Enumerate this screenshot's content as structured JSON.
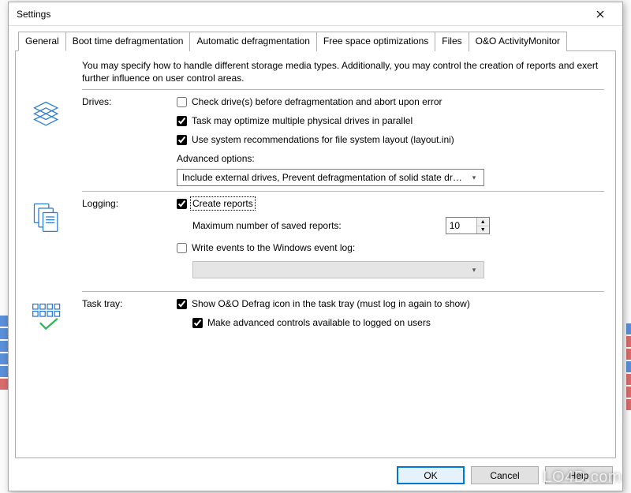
{
  "window": {
    "title": "Settings"
  },
  "tabs": {
    "general": "General",
    "boot": "Boot time defragmentation",
    "auto": "Automatic defragmentation",
    "free": "Free space optimizations",
    "files": "Files",
    "monitor": "O&O ActivityMonitor"
  },
  "intro": "You may specify how to handle different storage media types. Additionally, you may control the creation of reports and exert further influence on user control areas.",
  "drives": {
    "label": "Drives:",
    "check_before": {
      "label": "Check drive(s) before defragmentation and abort upon error",
      "checked": false
    },
    "parallel": {
      "label": "Task may optimize multiple physical drives in parallel",
      "checked": true
    },
    "layout_ini": {
      "label": "Use system recommendations for file system layout (layout.ini)",
      "checked": true
    },
    "advanced_label": "Advanced options:",
    "advanced_value": "Include external drives, Prevent defragmentation of solid state dr…"
  },
  "logging": {
    "label": "Logging:",
    "create_reports": {
      "label": "Create reports",
      "checked": true
    },
    "max_label": "Maximum number of saved reports:",
    "max_value": "10",
    "write_eventlog": {
      "label": "Write events to the Windows event log:",
      "checked": false
    },
    "eventlog_combo": ""
  },
  "tasktray": {
    "label": "Task tray:",
    "show_icon": {
      "label": "Show O&O Defrag icon in the task tray (must log in again to show)",
      "checked": true
    },
    "advanced_controls": {
      "label": "Make advanced controls available to logged on users",
      "checked": true
    }
  },
  "buttons": {
    "ok": "OK",
    "cancel": "Cancel",
    "help": "Help"
  },
  "watermark": "LO4D.com"
}
